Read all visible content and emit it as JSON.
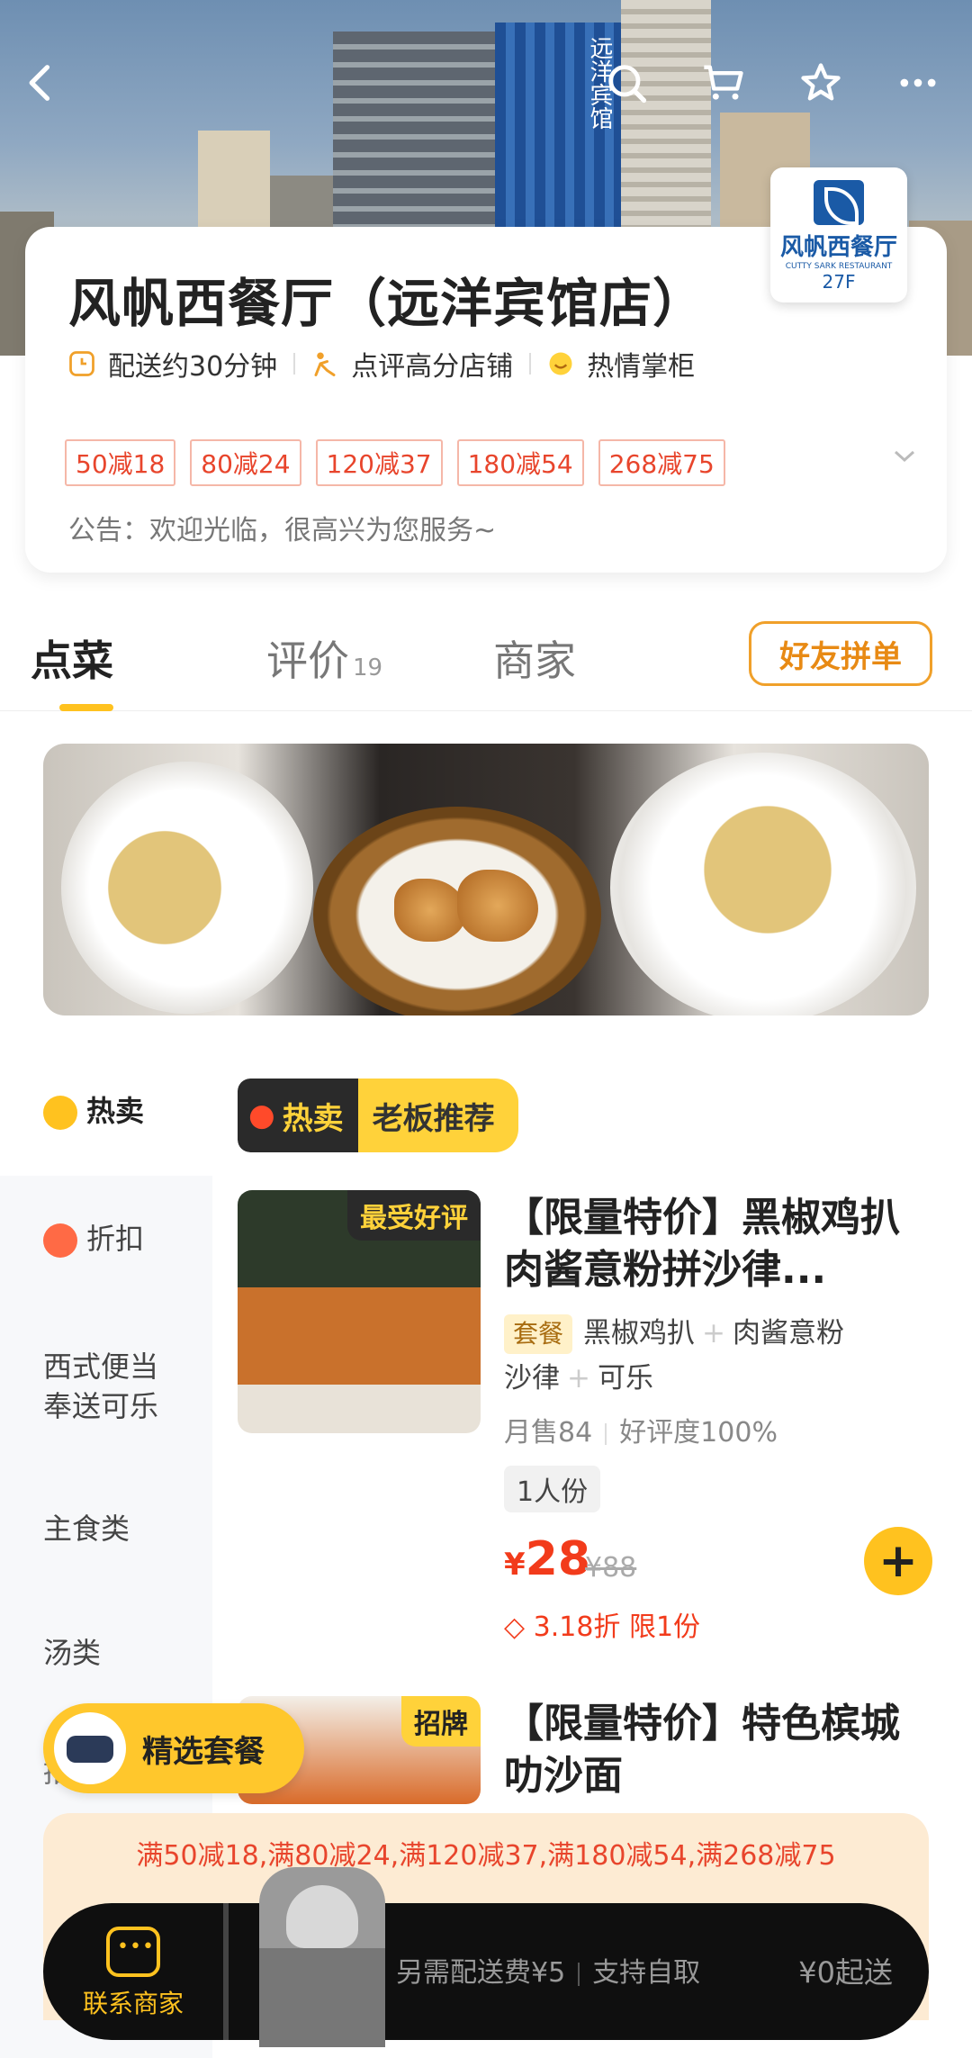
{
  "store": {
    "name": "风帆西餐厅（远洋宾馆店）",
    "logo_text_cn": "风帆西餐厅",
    "logo_text_en": "CUTTY SARK RESTAURANT",
    "logo_floor": "27F",
    "building_sign": "远洋宾馆",
    "features": [
      {
        "label": "配送约30分钟",
        "icon": "clock-icon"
      },
      {
        "label": "点评高分店铺",
        "icon": "person-star-icon"
      },
      {
        "label": "热情掌柜",
        "icon": "smile-icon"
      }
    ],
    "coupons": [
      "50减18",
      "80减24",
      "120减37",
      "180减54",
      "268减75"
    ],
    "notice": "公告：欢迎光临，很高兴为您服务~"
  },
  "tabs": [
    {
      "label": "点菜",
      "count": ""
    },
    {
      "label": "评价",
      "count": "19"
    },
    {
      "label": "商家",
      "count": ""
    }
  ],
  "group_order_label": "好友拼单",
  "categories": [
    {
      "label": "热卖",
      "icon": "flame-icon"
    },
    {
      "label": "折扣",
      "icon": "discount-tag-icon"
    },
    {
      "label": "西式便当奉送可乐",
      "icon": ""
    },
    {
      "label": "主食类",
      "icon": ""
    },
    {
      "label": "汤类",
      "icon": ""
    },
    {
      "label": "招粉",
      "icon": ""
    }
  ],
  "section_tag": {
    "hot": "热卖",
    "title": "老板推荐"
  },
  "products": [
    {
      "ribbon": "最受好评",
      "name": "【限量特价】黑椒鸡扒肉酱意粉拼沙律...",
      "set_badge": "套餐",
      "set_items": [
        "黑椒鸡扒",
        "肉酱意粉",
        "沙律",
        "可乐"
      ],
      "monthly_sales": "月售84",
      "rating": "好评度100%",
      "portion": "1人份",
      "price_symbol": "¥",
      "price": "28",
      "original_price": "¥88",
      "discount": "3.18折 限1份"
    },
    {
      "ribbon": "招牌",
      "name": "【限量特价】特色槟城叻沙面"
    }
  ],
  "float_button_label": "精选套餐",
  "promo_text": "满50减18,满80减24,满120减37,满180减54,满268减75",
  "cart": {
    "contact_label": "联系商家",
    "delivery_fee": "另需配送费¥5",
    "self_pickup": "支持自取",
    "min_order": "¥0起送"
  },
  "colors": {
    "accent_yellow": "#ffc21f",
    "price_red": "#f23b1b",
    "coupon_red": "#e8452c"
  }
}
